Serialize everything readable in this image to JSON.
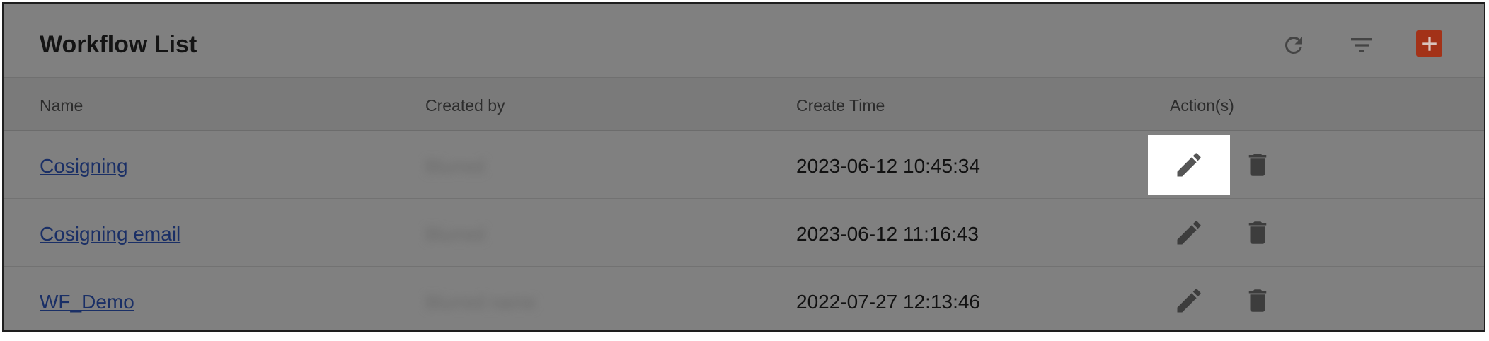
{
  "header": {
    "title": "Workflow List",
    "icons": {
      "refresh": "refresh-icon",
      "filter": "filter-icon",
      "add": "add-icon"
    },
    "add_button_color": "#a33218"
  },
  "table": {
    "columns": [
      "Name",
      "Created by",
      "Create Time",
      "Action(s)"
    ],
    "rows": [
      {
        "name": "Cosigning",
        "created_by": "Blurred",
        "create_time": "2023-06-12 10:45:34",
        "edit_highlighted": true
      },
      {
        "name": "Cosigning email",
        "created_by": "Blurred",
        "create_time": "2023-06-12 11:16:43",
        "edit_highlighted": false
      },
      {
        "name": "WF_Demo",
        "created_by": "Blurred name",
        "create_time": "2022-07-27 12:13:46",
        "edit_highlighted": false
      }
    ],
    "action_icons": [
      "edit-icon",
      "delete-icon"
    ]
  },
  "colors": {
    "overlay_background": "#808080",
    "link": "#1a2f66",
    "icon": "#555555",
    "highlight": "#ffffff"
  }
}
